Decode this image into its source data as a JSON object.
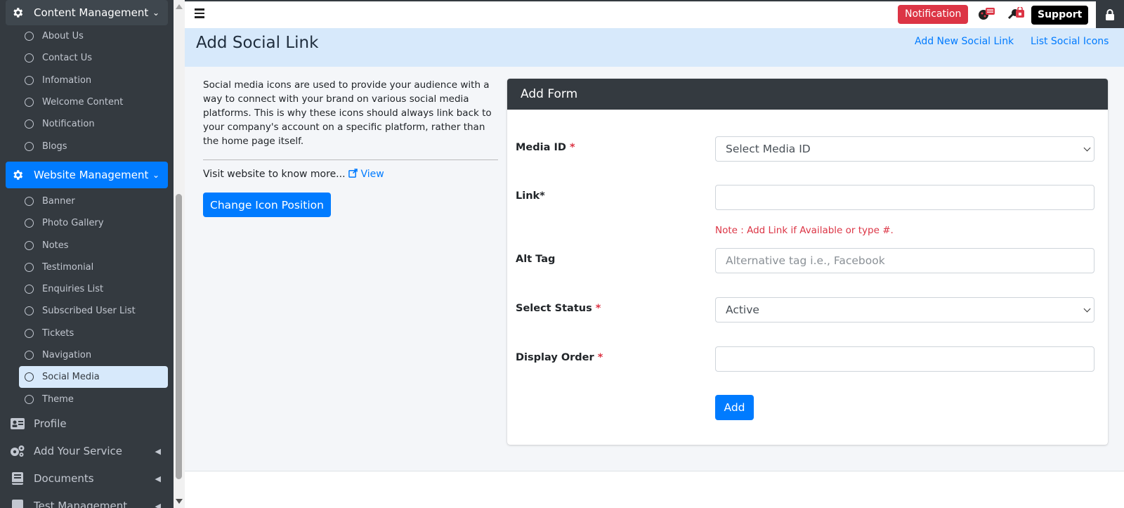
{
  "sidebar": {
    "content_group": "Content Management",
    "content_items": [
      "About Us",
      "Contact Us",
      "Infomation",
      "Welcome Content",
      "Notification",
      "Blogs"
    ],
    "website_group": "Website Management",
    "website_items": [
      "Banner",
      "Photo Gallery",
      "Notes",
      "Testimonial",
      "Enquiries List",
      "Subscribed User List",
      "Tickets",
      "Navigation",
      "Social Media",
      "Theme"
    ],
    "selected_item": "Social Media",
    "profile": "Profile",
    "add_service": "Add Your Service",
    "documents": "Documents",
    "test_management": "Test Management"
  },
  "topbar": {
    "notification_label": "Notification",
    "support_label": "Support"
  },
  "header": {
    "title": "Add Social Link",
    "link_add_new": "Add New Social Link",
    "link_list": "List Social Icons"
  },
  "info": {
    "description": "Social media icons are used to provide your audience with a way to connect with your brand on various social media platforms. This is why these icons should always link back to your company's account on a specific platform, rather than the home page itself.",
    "visit_text": "Visit website to know more...",
    "view_label": "View",
    "change_button": "Change Icon Position"
  },
  "form": {
    "title": "Add Form",
    "media_id_label": "Media ID",
    "media_id_value": "Select Media ID",
    "link_label": "Link*",
    "link_value": "",
    "note": "Note : Add Link if Available or type #.",
    "alt_tag_label": "Alt Tag",
    "alt_tag_placeholder": "Alternative tag i.e., Facebook",
    "status_label": "Select Status",
    "status_value": "Active",
    "display_order_label": "Display Order",
    "display_order_value": "",
    "required_mark": "*",
    "add_button": "Add"
  },
  "colors": {
    "sidebar_bg": "#343a40",
    "primary": "#007bff",
    "danger": "#dc3545",
    "header_band": "#d7e9fb"
  }
}
